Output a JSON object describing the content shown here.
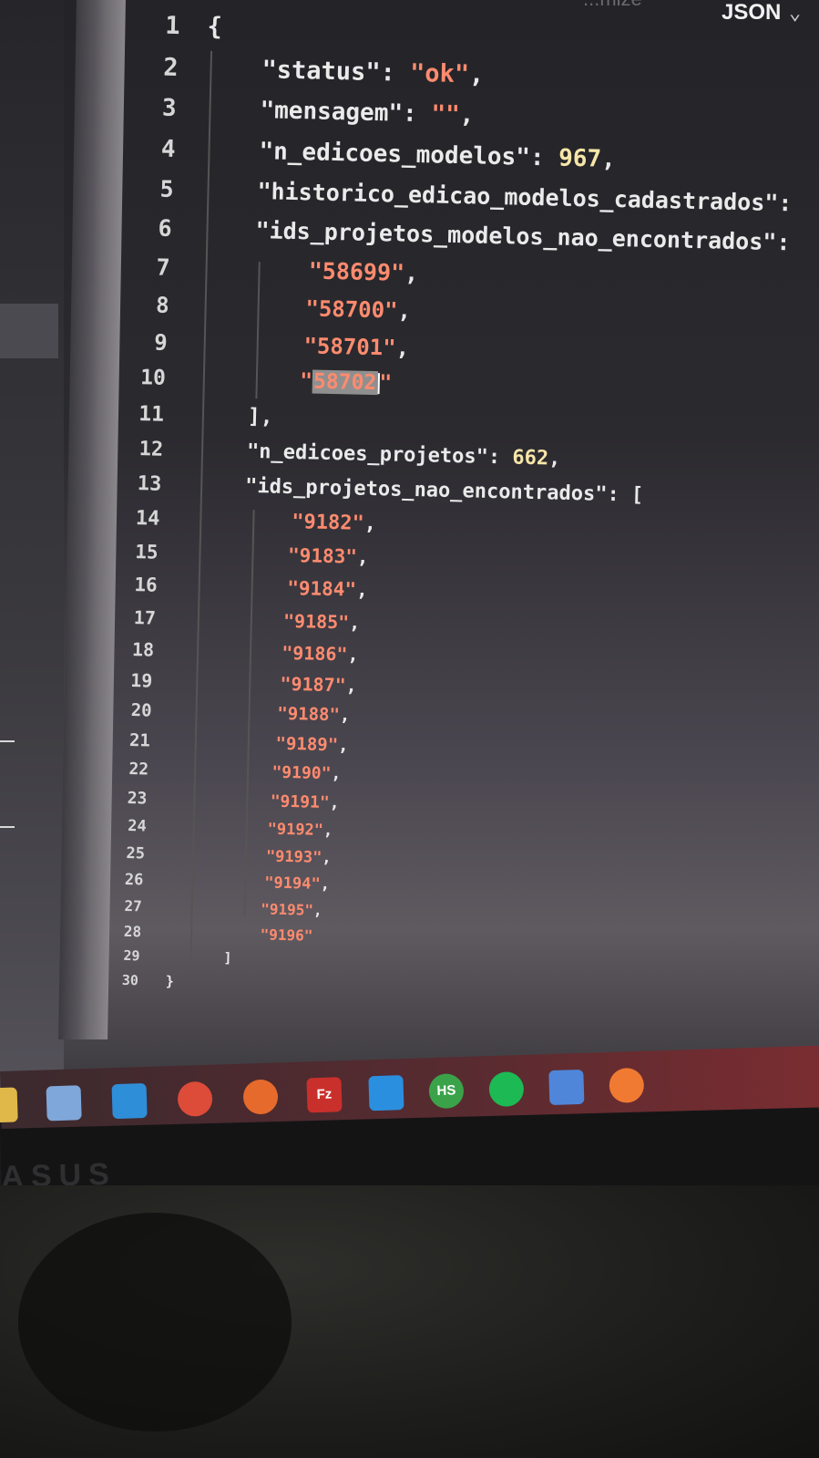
{
  "header": {
    "language_label": "JSON",
    "faded_label": "...mize"
  },
  "editor": {
    "lines": [
      {
        "n": "1",
        "parts": [
          [
            "punc",
            "{"
          ]
        ]
      },
      {
        "n": "2",
        "parts": [
          [
            "key",
            "\"status\""
          ],
          [
            "punc",
            ": "
          ],
          [
            "str",
            "\"ok\""
          ],
          [
            "punc",
            ","
          ]
        ]
      },
      {
        "n": "3",
        "parts": [
          [
            "key",
            "\"mensagem\""
          ],
          [
            "punc",
            ": "
          ],
          [
            "str",
            "\"\""
          ],
          [
            "punc",
            ","
          ]
        ]
      },
      {
        "n": "4",
        "parts": [
          [
            "key",
            "\"n_edicoes_modelos\""
          ],
          [
            "punc",
            ": "
          ],
          [
            "num",
            "967"
          ],
          [
            "punc",
            ","
          ]
        ]
      },
      {
        "n": "5",
        "parts": [
          [
            "key",
            "\"historico_edicao_modelos_cadastrados\""
          ],
          [
            "punc",
            ":"
          ]
        ]
      },
      {
        "n": "6",
        "parts": [
          [
            "key",
            "\"ids_projetos_modelos_nao_encontrados\""
          ],
          [
            "punc",
            ":"
          ]
        ]
      },
      {
        "n": "7",
        "parts": [
          [
            "str",
            "    \"58699\""
          ],
          [
            "punc",
            ","
          ]
        ]
      },
      {
        "n": "8",
        "parts": [
          [
            "str",
            "    \"58700\""
          ],
          [
            "punc",
            ","
          ]
        ]
      },
      {
        "n": "9",
        "parts": [
          [
            "str",
            "    \"58701\""
          ],
          [
            "punc",
            ","
          ]
        ]
      },
      {
        "n": "10",
        "parts": [
          [
            "str",
            "    \""
          ],
          [
            "sel",
            "58702"
          ],
          [
            "cur",
            ""
          ],
          [
            "str",
            "\""
          ]
        ]
      },
      {
        "n": "11",
        "parts": [
          [
            "punc",
            "],"
          ]
        ]
      },
      {
        "n": "12",
        "parts": [
          [
            "key",
            "\"n_edicoes_projetos\""
          ],
          [
            "punc",
            ": "
          ],
          [
            "num",
            "662"
          ],
          [
            "punc",
            ","
          ]
        ]
      },
      {
        "n": "13",
        "parts": [
          [
            "key",
            "\"ids_projetos_nao_encontrados\""
          ],
          [
            "punc",
            ": ["
          ]
        ]
      },
      {
        "n": "14",
        "parts": [
          [
            "str",
            "    \"9182\""
          ],
          [
            "punc",
            ","
          ]
        ]
      },
      {
        "n": "15",
        "parts": [
          [
            "str",
            "    \"9183\""
          ],
          [
            "punc",
            ","
          ]
        ]
      },
      {
        "n": "16",
        "parts": [
          [
            "str",
            "    \"9184\""
          ],
          [
            "punc",
            ","
          ]
        ]
      },
      {
        "n": "17",
        "parts": [
          [
            "str",
            "    \"9185\""
          ],
          [
            "punc",
            ","
          ]
        ]
      },
      {
        "n": "18",
        "parts": [
          [
            "str",
            "    \"9186\""
          ],
          [
            "punc",
            ","
          ]
        ]
      },
      {
        "n": "19",
        "parts": [
          [
            "str",
            "    \"9187\""
          ],
          [
            "punc",
            ","
          ]
        ]
      },
      {
        "n": "20",
        "parts": [
          [
            "str",
            "    \"9188\""
          ],
          [
            "punc",
            ","
          ]
        ]
      },
      {
        "n": "21",
        "parts": [
          [
            "str",
            "    \"9189\""
          ],
          [
            "punc",
            ","
          ]
        ]
      },
      {
        "n": "22",
        "parts": [
          [
            "str",
            "    \"9190\""
          ],
          [
            "punc",
            ","
          ]
        ]
      },
      {
        "n": "23",
        "parts": [
          [
            "str",
            "    \"9191\""
          ],
          [
            "punc",
            ","
          ]
        ]
      },
      {
        "n": "24",
        "parts": [
          [
            "str",
            "    \"9192\""
          ],
          [
            "punc",
            ","
          ]
        ]
      },
      {
        "n": "25",
        "parts": [
          [
            "str",
            "    \"9193\""
          ],
          [
            "punc",
            ","
          ]
        ]
      },
      {
        "n": "26",
        "parts": [
          [
            "str",
            "    \"9194\""
          ],
          [
            "punc",
            ","
          ]
        ]
      },
      {
        "n": "27",
        "parts": [
          [
            "str",
            "    \"9195\""
          ],
          [
            "punc",
            ","
          ]
        ]
      },
      {
        "n": "28",
        "parts": [
          [
            "str",
            "    \"9196\""
          ]
        ]
      },
      {
        "n": "29",
        "parts": [
          [
            "punc",
            "]"
          ]
        ]
      },
      {
        "n": "30",
        "parts": [
          [
            "punc",
            "}"
          ]
        ]
      }
    ]
  },
  "taskbar": {
    "icons": [
      {
        "name": "file-explorer-icon",
        "color": "#e0b84a"
      },
      {
        "name": "calendar-app-icon",
        "color": "#7fa7d9"
      },
      {
        "name": "mail-icon",
        "color": "#2f8ed8"
      },
      {
        "name": "chrome-icon",
        "color": "#dd4b39"
      },
      {
        "name": "firefox-icon",
        "color": "#e66a2c"
      },
      {
        "name": "filezilla-icon",
        "color": "#c9302c",
        "label": "Fz"
      },
      {
        "name": "vscode-icon",
        "color": "#2b8fe0"
      },
      {
        "name": "heidisql-icon",
        "color": "#3aa34a",
        "label": "HS"
      },
      {
        "name": "spotify-icon",
        "color": "#1db954"
      },
      {
        "name": "notepad-icon",
        "color": "#4f86d9"
      },
      {
        "name": "postman-icon",
        "color": "#f07a32"
      }
    ]
  }
}
